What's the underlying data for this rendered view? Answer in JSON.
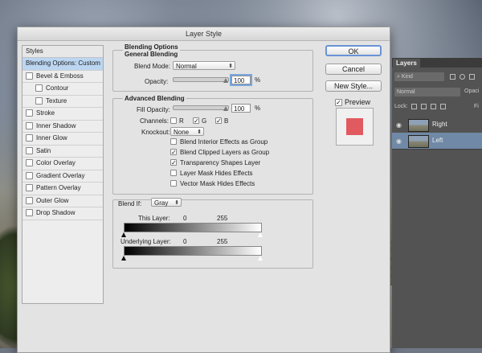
{
  "dialog": {
    "title": "Layer Style"
  },
  "styles_panel": {
    "header": "Styles",
    "items": [
      {
        "label": "Blending Options: Custom",
        "selected": true,
        "checkbox": false,
        "sub": false
      },
      {
        "label": "Bevel & Emboss",
        "checkbox": true,
        "sub": false
      },
      {
        "label": "Contour",
        "checkbox": true,
        "sub": true
      },
      {
        "label": "Texture",
        "checkbox": true,
        "sub": true
      },
      {
        "label": "Stroke",
        "checkbox": true,
        "sub": false
      },
      {
        "label": "Inner Shadow",
        "checkbox": true,
        "sub": false
      },
      {
        "label": "Inner Glow",
        "checkbox": true,
        "sub": false
      },
      {
        "label": "Satin",
        "checkbox": true,
        "sub": false
      },
      {
        "label": "Color Overlay",
        "checkbox": true,
        "sub": false
      },
      {
        "label": "Gradient Overlay",
        "checkbox": true,
        "sub": false
      },
      {
        "label": "Pattern Overlay",
        "checkbox": true,
        "sub": false
      },
      {
        "label": "Outer Glow",
        "checkbox": true,
        "sub": false
      },
      {
        "label": "Drop Shadow",
        "checkbox": true,
        "sub": false
      }
    ]
  },
  "blending": {
    "section_title": "Blending Options",
    "general_title": "General Blending",
    "blend_mode_label": "Blend Mode:",
    "blend_mode_value": "Normal",
    "opacity_label": "Opacity:",
    "opacity_value": "100",
    "opacity_unit": "%",
    "advanced_title": "Advanced Blending",
    "fill_opacity_label": "Fill Opacity:",
    "fill_opacity_value": "100",
    "fill_opacity_unit": "%",
    "channels_label": "Channels:",
    "channel_r": "R",
    "channel_g": "G",
    "channel_b": "B",
    "knockout_label": "Knockout:",
    "knockout_value": "None",
    "options": [
      {
        "label": "Blend Interior Effects as Group",
        "checked": false
      },
      {
        "label": "Blend Clipped Layers as Group",
        "checked": true
      },
      {
        "label": "Transparency Shapes Layer",
        "checked": true
      },
      {
        "label": "Layer Mask Hides Effects",
        "checked": false
      },
      {
        "label": "Vector Mask Hides Effects",
        "checked": false
      }
    ],
    "blend_if_label": "Blend If:",
    "blend_if_value": "Gray",
    "this_layer_label": "This Layer:",
    "this_layer_min": "0",
    "this_layer_max": "255",
    "underlying_label": "Underlying Layer:",
    "underlying_min": "0",
    "underlying_max": "255"
  },
  "buttons": {
    "ok": "OK",
    "cancel": "Cancel",
    "new_style": "New Style...",
    "preview": "Preview",
    "preview_checked": true,
    "preview_color": "#e05a5f"
  },
  "layers_panel": {
    "tab": "Layers",
    "kind_label": "Kind",
    "mode": "Normal",
    "opacity_label": "Opaci",
    "lock_label": "Lock:",
    "fill_label": "Fi",
    "layers": [
      {
        "name": "Right",
        "active": false
      },
      {
        "name": "Left",
        "active": true
      }
    ]
  }
}
